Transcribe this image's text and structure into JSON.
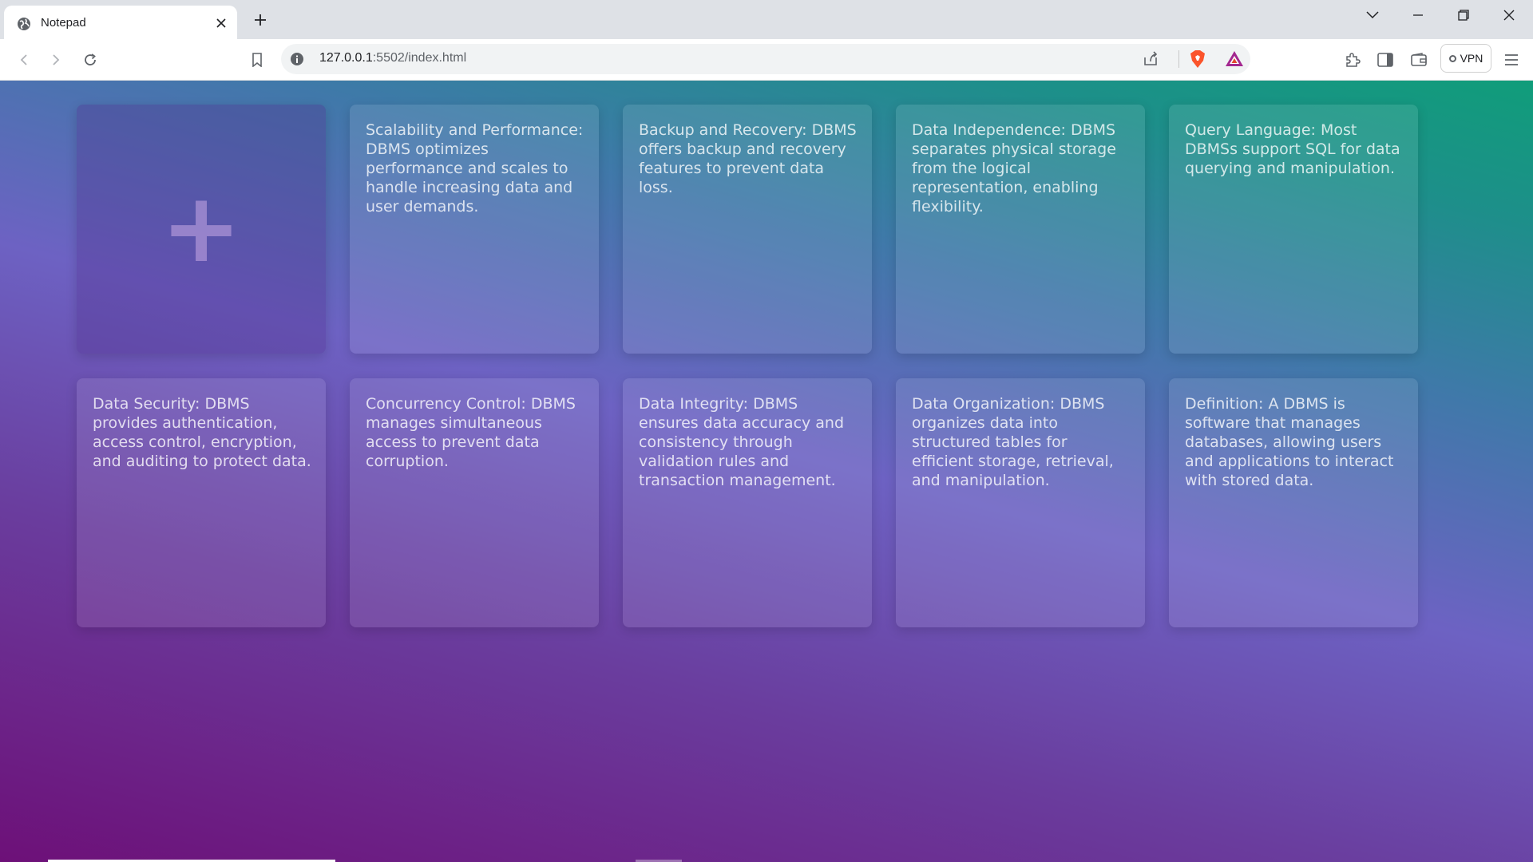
{
  "tab": {
    "title": "Notepad"
  },
  "toolbar": {
    "url_host": "127.0.0.1",
    "url_rest": ":5502/index.html",
    "vpn_label": "VPN"
  },
  "notes": [
    {
      "text": "Scalability and Performance: DBMS optimizes performance and scales to handle increasing data and user demands."
    },
    {
      "text": "Backup and Recovery: DBMS offers backup and recovery features to prevent data loss."
    },
    {
      "text": "Data Independence: DBMS separates physical storage from the logical representation, enabling flexibility."
    },
    {
      "text": "Query Language: Most DBMSs support SQL for data querying and manipulation."
    },
    {
      "text": "Data Security: DBMS provides authentication, access control, encryption, and auditing to protect data."
    },
    {
      "text": "Concurrency Control: DBMS manages simultaneous access to prevent data corruption."
    },
    {
      "text": "Data Integrity: DBMS ensures data accuracy and consistency through validation rules and transaction management."
    },
    {
      "text": "Data Organization: DBMS organizes data into structured tables for efficient storage, retrieval, and manipulation."
    },
    {
      "text": "Definition: A DBMS is software that manages databases, allowing users and applications to interact with stored data."
    }
  ],
  "add_button": {
    "symbol": "+"
  },
  "colors": {
    "gradient_start": "#6d1078",
    "gradient_mid": "#6d62c3",
    "gradient_end": "#109d7a"
  },
  "icons": [
    "globe-icon",
    "close-icon",
    "plus-icon",
    "chevron-down-icon",
    "minimize-icon",
    "restore-icon",
    "back-icon",
    "forward-icon",
    "reload-icon",
    "bookmark-icon",
    "info-icon",
    "share-icon",
    "brave-shield-icon",
    "brave-rewards-icon",
    "extensions-icon",
    "sidebar-icon",
    "wallet-icon",
    "menu-icon"
  ]
}
